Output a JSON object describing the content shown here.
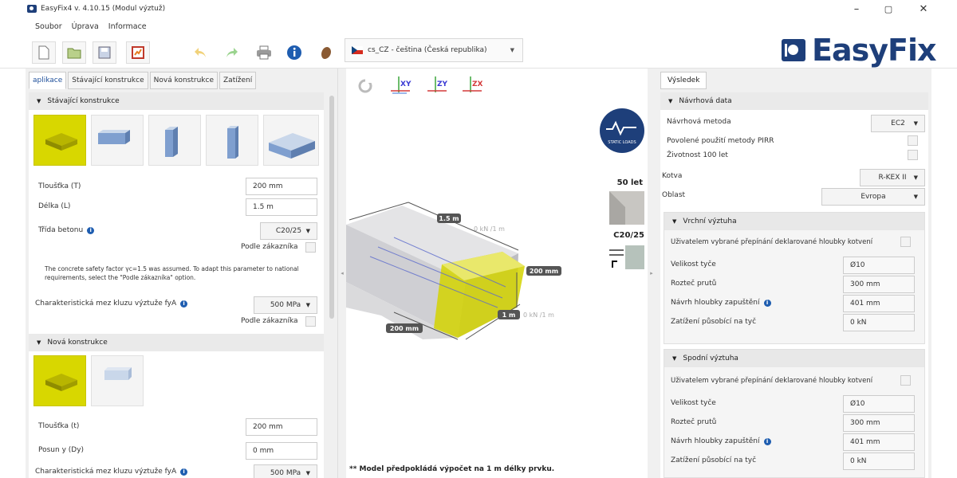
{
  "window": {
    "title": "EasyFix4 v. 4.10.15 (Modul výztuž)",
    "minimize": "–",
    "maximize": "▢",
    "close": "✕"
  },
  "menu": [
    "Soubor",
    "Úprava",
    "Informace"
  ],
  "toolbar": {
    "language": "cs_CZ - čeština (Česká republika)"
  },
  "logo": "EasyFix",
  "left": {
    "tabs": [
      "aplikace",
      "Stávající konstrukce",
      "Nová konstrukce",
      "Zatížení"
    ],
    "existing": {
      "heading": "Stávající konstrukce",
      "thickness_label": "Tloušťka (T)",
      "thickness_value": "200 mm",
      "length_label": "Délka (L)",
      "length_value": "1.5 m",
      "concrete_label": "Třída betonu",
      "concrete_value": "C20/25",
      "custom_label": "Podle zákazníka",
      "note": "The concrete safety factor γc=1.5 was assumed. To adapt this parameter to national requirements, select the \"Podle zákazníka\" option.",
      "yield_label": "Charakteristická mez kluzu výztuže fyA",
      "yield_value": "500 MPa",
      "custom_label2": "Podle zákazníka"
    },
    "new": {
      "heading": "Nová konstrukce",
      "thickness_label": "Tloušťka (t)",
      "thickness_value": "200 mm",
      "shift_label": "Posun y (Dy)",
      "shift_value": "0 mm",
      "yield_label": "Charakteristická mez kluzu výztuže fyA",
      "yield_value": "500 MPa"
    }
  },
  "view": {
    "axes": [
      "XY",
      "ZY",
      "ZX"
    ],
    "years": "50 let",
    "concrete": "C20/25",
    "static_loads": "STATIC LOADS",
    "dim_length": "1.5 m",
    "dim_height": "200 mm",
    "dim_width": "200 mm",
    "dim_len2": "1 m",
    "load1": "0 kN /1 m",
    "load2": "0 kN /1 m",
    "note": "** Model předpokládá výpočet na 1 m délky prvku."
  },
  "right": {
    "tab": "Výsledek",
    "design_heading": "Návrhová data",
    "method_label": "Návrhová metoda",
    "method_value": "EC2",
    "pirr_label": "Povolené použití metody PIRR",
    "life_label": "Životnost 100 let",
    "anchor_label": "Kotva",
    "anchor_value": "R-KEX II",
    "region_label": "Oblast",
    "region_value": "Evropa",
    "top": {
      "heading": "Vrchní výztuha",
      "user_override": "Uživatelem vybrané přepínání deklarované hloubky kotvení",
      "size_label": "Velikost tyče",
      "size_value": "Ø10",
      "spacing_label": "Rozteč prutů",
      "spacing_value": "300 mm",
      "depth_label": "Návrh hloubky zapuštění",
      "depth_value": "401 mm",
      "load_label": "Zatížení působící na tyč",
      "load_value": "0 kN"
    },
    "bottom": {
      "heading": "Spodní výztuha",
      "user_override": "Uživatelem vybrané přepínání deklarované hloubky kotvení",
      "size_label": "Velikost tyče",
      "size_value": "Ø10",
      "spacing_label": "Rozteč prutů",
      "spacing_value": "300 mm",
      "depth_label": "Návrh hloubky zapuštění",
      "depth_value": "401 mm",
      "load_label": "Zatížení působící na tyč",
      "load_value": "0 kN"
    }
  },
  "colors": {
    "accent": "#1e3f7a",
    "selected": "#d8d700",
    "info": "#1e5db0"
  }
}
